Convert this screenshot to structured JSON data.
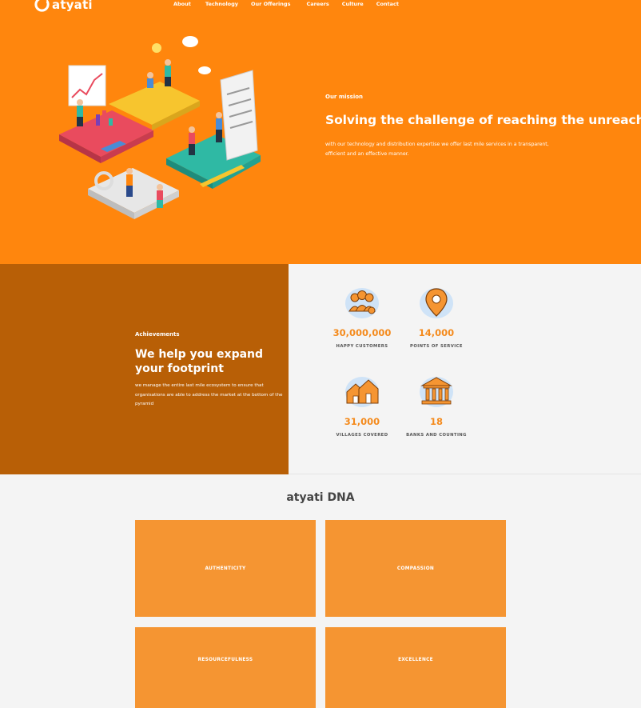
{
  "brand": {
    "name": "atyati"
  },
  "nav": {
    "items": [
      "About",
      "Technology",
      "Our Offerings",
      "Careers",
      "Culture",
      "Contact"
    ]
  },
  "mission": {
    "kicker": "Our mission",
    "title": "Solving the challenge of reaching the unreached",
    "text": "with our technology and distribution expertise we offer last mile services in a transparent, efficient and an effective manner."
  },
  "achievements": {
    "kicker": "Achievements",
    "title": "We help you expand your footprint",
    "text": "we manage the entire last mile ecosystem to ensure that organisations are able to address the market at the bottom of the pyramid"
  },
  "stats": [
    {
      "value": "30,000,000",
      "label": "HAPPY CUSTOMERS",
      "icon": "customers-icon"
    },
    {
      "value": "14,000",
      "label": "POINTS OF SERVICE",
      "icon": "location-pin-icon"
    },
    {
      "value": "31,000",
      "label": "VILLAGES COVERED",
      "icon": "village-icon"
    },
    {
      "value": "18",
      "label": "BANKS AND COUNTING",
      "icon": "bank-icon"
    }
  ],
  "dna": {
    "title": "atyati DNA",
    "cards": [
      "AUTHENTICITY",
      "COMPASSION",
      "RESOURCEFULNESS",
      "EXCELLENCE"
    ]
  },
  "colors": {
    "hero": "#ff860d",
    "achievements": "#b85f06",
    "accent": "#f48a1c",
    "card": "#f59532"
  }
}
